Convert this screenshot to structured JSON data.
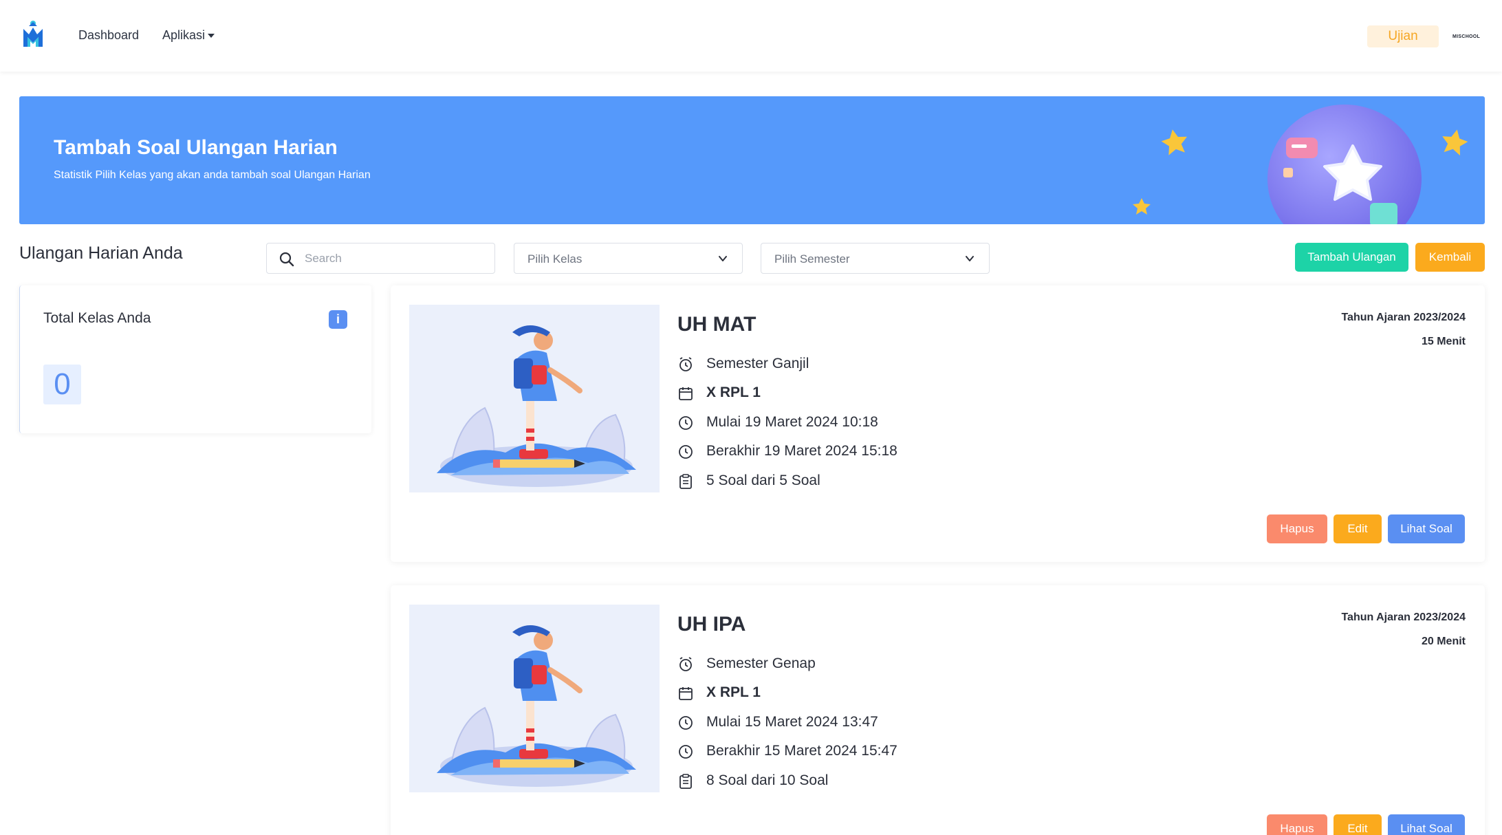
{
  "navbar": {
    "links": [
      "Dashboard",
      "Aplikasi"
    ],
    "badge": "Ujian",
    "brand_mini": "MISCHOOL"
  },
  "hero": {
    "title": "Tambah Soal Ulangan Harian",
    "subtitle": "Statistik Pilih Kelas yang akan anda tambah soal Ulangan Harian"
  },
  "filters": {
    "section_title": "Ulangan Harian Anda",
    "search_placeholder": "Search",
    "kelas_label": "Pilih Kelas",
    "semester_label": "Pilih Semester",
    "add_button": "Tambah Ulangan",
    "back_button": "Kembali"
  },
  "stats": {
    "label": "Total Kelas Anda",
    "info_icon": "i",
    "value": "0"
  },
  "exams": [
    {
      "title": "UH MAT",
      "year": "Tahun Ajaran 2023/2024",
      "duration": "15 Menit",
      "semester": "Semester Ganjil",
      "kelas": "X RPL 1",
      "start": "Mulai 19 Maret 2024 10:18",
      "end": "Berakhir 19 Maret 2024 15:18",
      "questions": "5 Soal dari 5 Soal",
      "buttons": {
        "delete": "Hapus",
        "edit": "Edit",
        "view": "Lihat Soal"
      }
    },
    {
      "title": "UH IPA",
      "year": "Tahun Ajaran 2023/2024",
      "duration": "20 Menit",
      "semester": "Semester Genap",
      "kelas": "X RPL 1",
      "start": "Mulai 15 Maret 2024 13:47",
      "end": "Berakhir 15 Maret 2024 15:47",
      "questions": "8 Soal dari 10 Soal",
      "buttons": {
        "delete": "Hapus",
        "edit": "Edit",
        "view": "Lihat Soal"
      }
    }
  ],
  "colors": {
    "hero_blue": "#5599fb",
    "primary_blue": "#5a8ff2",
    "green": "#1dd3a7",
    "orange": "#fbaa1d",
    "salmon": "#fa8a6c"
  }
}
